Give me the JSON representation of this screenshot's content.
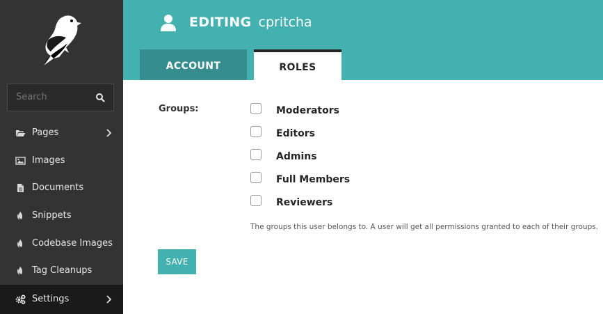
{
  "sidebar": {
    "search_placeholder": "Search",
    "items": [
      {
        "label": "Pages",
        "icon": "folder-icon",
        "has_submenu": true
      },
      {
        "label": "Images",
        "icon": "image-icon"
      },
      {
        "label": "Documents",
        "icon": "document-icon"
      },
      {
        "label": "Snippets",
        "icon": "snippet-icon"
      },
      {
        "label": "Codebase Images",
        "icon": "snippet-icon"
      },
      {
        "label": "Tag Cleanups",
        "icon": "snippet-icon"
      },
      {
        "label": "Settings",
        "icon": "cogs-icon",
        "has_submenu": true,
        "active": true
      }
    ]
  },
  "header": {
    "editing": "EDITING",
    "username": "cpritcha",
    "color": "#43b1b0"
  },
  "tabs": [
    {
      "label": "ACCOUNT",
      "active": false
    },
    {
      "label": "ROLES",
      "active": true
    }
  ],
  "form": {
    "groups_label": "Groups:",
    "groups": [
      {
        "label": "Moderators",
        "checked": false
      },
      {
        "label": "Editors",
        "checked": false
      },
      {
        "label": "Admins",
        "checked": false
      },
      {
        "label": "Full Members",
        "checked": false
      },
      {
        "label": "Reviewers",
        "checked": false
      }
    ],
    "help_text": "The groups this user belongs to. A user will get all permissions granted to each of their groups.",
    "save_label": "SAVE"
  }
}
